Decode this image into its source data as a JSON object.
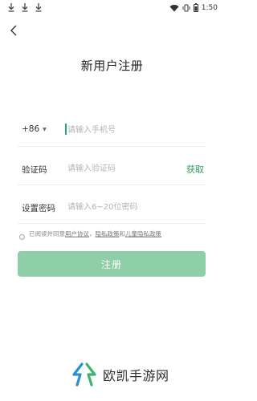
{
  "status_bar": {
    "time": "1:50",
    "icons": [
      "download-icon",
      "download-icon",
      "download-icon",
      "wifi-icon",
      "vibrate-icon",
      "battery-icon"
    ]
  },
  "header": {
    "title": "新用户注册",
    "back_icon": "chevron-left-icon"
  },
  "phone_row": {
    "country_code": "+86",
    "placeholder": "请输入手机号"
  },
  "code_row": {
    "label": "验证码",
    "placeholder": "请输入验证码",
    "get_code_label": "获取"
  },
  "password_row": {
    "label": "设置密码",
    "placeholder": "请输入6~20位密码"
  },
  "agreement": {
    "prefix": "已阅读并同意",
    "user_agreement": "用户协议",
    "sep1": "，",
    "privacy_policy": "隐私政策",
    "and": "和",
    "child_privacy_policy": "儿童隐私政策"
  },
  "submit_label": "注册",
  "watermark": {
    "text": "欧凯手游网"
  },
  "colors": {
    "accent": "#2e9b5e",
    "button_bg": "#8ecfa9"
  }
}
